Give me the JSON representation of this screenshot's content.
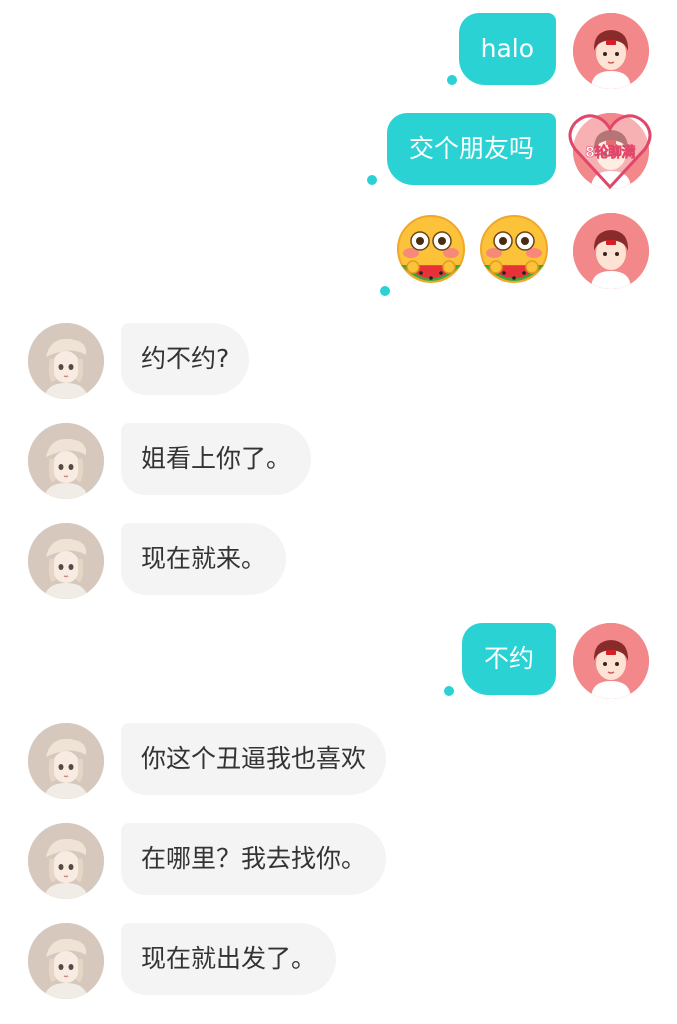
{
  "messages": [
    {
      "side": "me",
      "text": "halo"
    },
    {
      "side": "me",
      "text": "交个朋友吗",
      "badge": "8轮聊满"
    },
    {
      "side": "me",
      "type": "emoji",
      "icons": [
        "flushed-watermelon-emoji",
        "flushed-watermelon-emoji"
      ]
    },
    {
      "side": "her",
      "text": "约不约?"
    },
    {
      "side": "her",
      "text": "姐看上你了。"
    },
    {
      "side": "her",
      "text": "现在就来。"
    },
    {
      "side": "me",
      "text": "不约"
    },
    {
      "side": "her",
      "text": "你这个丑逼我也喜欢"
    },
    {
      "side": "her",
      "text": "在哪里？我去找你。"
    },
    {
      "side": "her",
      "text": "现在就出发了。"
    }
  ],
  "colors": {
    "my_bubble": "#2bd2d4",
    "her_bubble": "#f4f4f4",
    "my_avatar_bg": "#f3888a",
    "her_avatar_bg": "#d6c8bd",
    "badge_heart": "#e0476a"
  }
}
